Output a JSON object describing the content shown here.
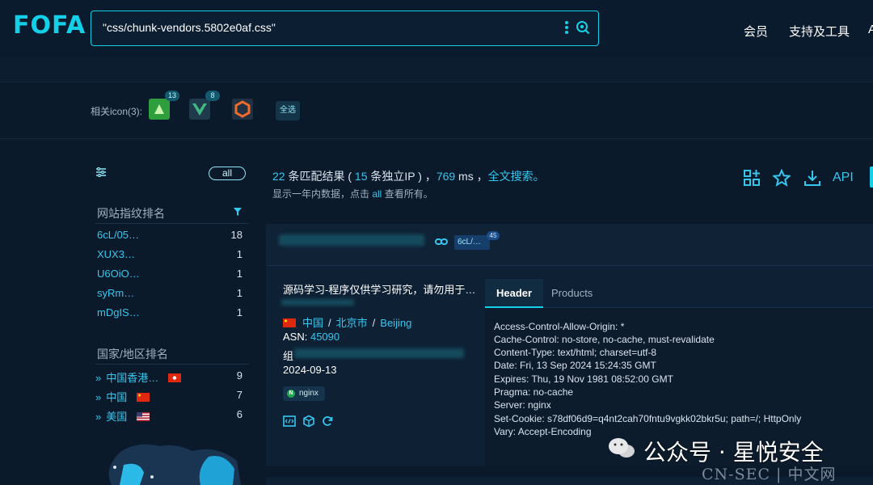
{
  "header": {
    "logo": "FOFA",
    "search_query": "\"css/chunk-vendors.5802e0af.css\"",
    "nav": [
      "会员",
      "支持及工具",
      "A"
    ]
  },
  "icons_row": {
    "label": "相关icon(3):",
    "icons": [
      {
        "name": "green-leaf-icon",
        "count": "13"
      },
      {
        "name": "vue-icon",
        "count": "8"
      },
      {
        "name": "hexagon-orange-icon",
        "count": ""
      }
    ],
    "select_all": "全选"
  },
  "sidebar": {
    "all_label": "all",
    "fingerprint_title": "网站指纹排名",
    "fingerprints": [
      {
        "label": "6cL/05…",
        "count": "18"
      },
      {
        "label": "XUX3…",
        "count": "1"
      },
      {
        "label": "U6OiO…",
        "count": "1"
      },
      {
        "label": "syRm…",
        "count": "1"
      },
      {
        "label": "mDgIS…",
        "count": "1"
      }
    ],
    "country_title": "国家/地区排名",
    "countries": [
      {
        "label": "中国香港…",
        "count": "9",
        "flag": "hk"
      },
      {
        "label": "中国",
        "count": "7",
        "flag": "cn"
      },
      {
        "label": "美国",
        "count": "6",
        "flag": "us"
      }
    ]
  },
  "stats": {
    "results": "22",
    "results_text": " 条匹配结果 ( ",
    "ips": "15",
    "ips_text": " 条独立IP ) ，",
    "ms": "769",
    "ms_text": " ms ，",
    "fulltext": "全文搜索。",
    "sub_prefix": "显示一年内数据，点击 ",
    "sub_link": "all",
    "sub_suffix": " 查看所有。",
    "api_label": "API"
  },
  "result": {
    "tag": "6cL/…",
    "tag_count": "45",
    "title": "源码学习-程序仅供学习研究，请勿用于…",
    "country": "中国",
    "city": "北京市",
    "city_en": "Beijing",
    "asn_label": "ASN: ",
    "asn": "45090",
    "org_label": "组",
    "date": "2024-09-13",
    "server_tag": "nginx",
    "tabs": [
      "Header",
      "Products"
    ],
    "header_lines": [
      "Access-Control-Allow-Origin: *",
      "Cache-Control: no-store, no-cache, must-revalidate",
      "Content-Type: text/html; charset=utf-8",
      "Date: Fri, 13 Sep 2024 15:24:35 GMT",
      "Expires: Thu, 19 Nov 1981 08:52:00 GMT",
      "Pragma: no-cache",
      "Server: nginx",
      "Set-Cookie: s78df06d9=q4nt2cah70fntu9vgkk02bkr5u; path=/; HttpOnly",
      "Vary: Accept-Encoding"
    ]
  },
  "watermark": {
    "text": "公众号 · 星悦安全",
    "site": "CN-SEC | 中文网"
  },
  "colors": {
    "accent": "#12d0e8",
    "link": "#36c6ee",
    "bg": "#0b1a2b"
  }
}
